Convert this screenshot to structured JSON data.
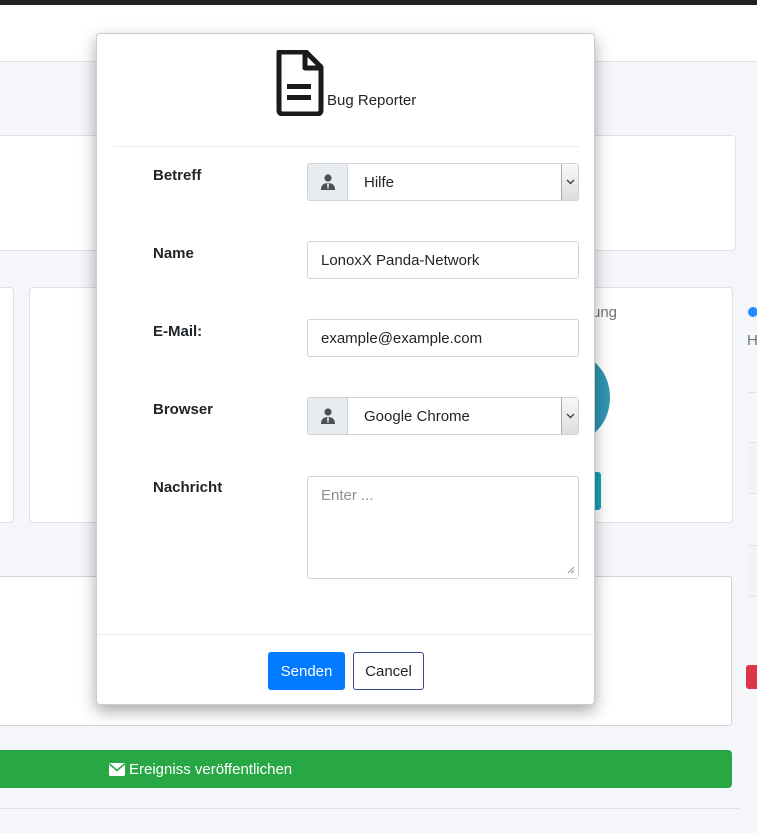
{
  "background": {
    "card_partial_text": "ung",
    "right_partial_text": "H",
    "publish_button_label": "Ereigniss veröffentlichen"
  },
  "modal": {
    "title": "Bug Reporter",
    "fields": {
      "subject": {
        "label": "Betreff",
        "value": "Hilfe"
      },
      "name": {
        "label": "Name",
        "value": "LonoxX Panda-Network"
      },
      "email": {
        "label": "E-Mail:",
        "value": "example@example.com"
      },
      "browser": {
        "label": "Browser",
        "value": "Google Chrome"
      },
      "message": {
        "label": "Nachricht",
        "placeholder": "Enter ..."
      }
    },
    "buttons": {
      "send": "Senden",
      "cancel": "Cancel"
    }
  },
  "colors": {
    "primary": "#007bff",
    "success": "#28a745",
    "info": "#17a2b8",
    "danger": "#dc3545"
  },
  "icons": {
    "header": "document-icon",
    "field_prepend": "user-tie-icon",
    "publish": "envelope-icon",
    "select": "chevron-down-icon"
  }
}
